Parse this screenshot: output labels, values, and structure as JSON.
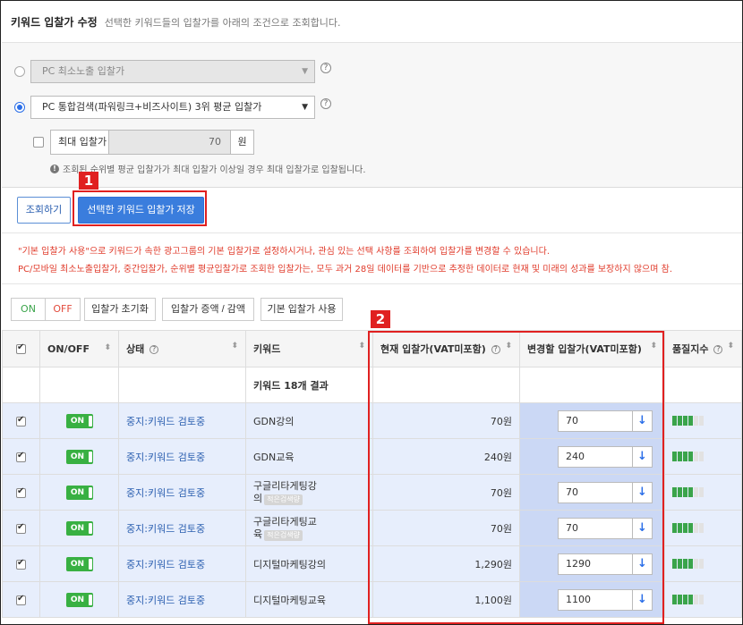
{
  "header": {
    "title": "키워드 입찰가 수정",
    "description": "선택한 키워드들의 입찰가를 아래의 조건으로 조회합니다."
  },
  "conditions": {
    "option1": "PC 최소노출 입찰가",
    "option2": "PC 통합검색(파워링크+비즈사이트) 3위 평균 입찰가",
    "max_bid_label": "최대 입찰가",
    "max_bid_value": "70",
    "max_bid_unit": "원",
    "note": "조회된 순위별 평균 입찰가가 최대 입찰가 이상일 경우 최대 입찰가로 입찰됩니다.",
    "help_glyph": "?",
    "info_glyph": "!",
    "arrow_glyph": "▼"
  },
  "actions": {
    "query": "조회하기",
    "save": "선택한 키워드 입찰가 저장"
  },
  "notice": {
    "line1": "\"기본 입찰가 사용\"으로 키워드가 속한 광고그룹의 기본 입찰가로 설정하시거나, 관심 있는 선택 사항를 조회하여 입찰가를 변경할 수 있습니다.",
    "line2": "PC/모바일 최소노출입찰가, 중간입찰가, 순위별 평균입찰가로 조회한 입찰가는, 모두 과거 28일 데이터를 기반으로 추정한 데이터로 현재 및 미래의 성과를 보장하지 않으며 참."
  },
  "toolbar": {
    "on": "ON",
    "off": "OFF",
    "reset": "입찰가 초기화",
    "adjust": "입찰가 증액 / 감액",
    "default": "기본 입찰가 사용"
  },
  "table": {
    "headers": {
      "onoff": "ON/OFF",
      "status": "상태",
      "keyword": "키워드",
      "current_bid": "현재 입찰가(VAT미포함)",
      "new_bid": "변경할 입찰가(VAT미포함)",
      "quality": "품질지수"
    },
    "sort_glyph": "⬍",
    "summary": "키워드 18개 결과",
    "toggle_label": "ON",
    "tag_label": "적은검색량",
    "apply_glyph": "↓",
    "rows": [
      {
        "status": "중지:키워드 검토중",
        "keyword": "GDN강의",
        "current_bid": "70원",
        "new_bid": "70",
        "quality": 4
      },
      {
        "status": "중지:키워드 검토중",
        "keyword": "GDN교육",
        "current_bid": "240원",
        "new_bid": "240",
        "quality": 4
      },
      {
        "status": "중지:키워드 검토중",
        "keyword_line1": "구글리타게팅강",
        "keyword_line2": "의",
        "current_bid": "70원",
        "new_bid": "70",
        "quality": 4
      },
      {
        "status": "중지:키워드 검토중",
        "keyword_line1": "구글리타게팅교",
        "keyword_line2": "육",
        "current_bid": "70원",
        "new_bid": "70",
        "quality": 4
      },
      {
        "status": "중지:키워드 검토중",
        "keyword": "디지털마케팅강의",
        "current_bid": "1,290원",
        "new_bid": "1290",
        "quality": 4
      },
      {
        "status": "중지:키워드 검토중",
        "keyword": "디지털마케팅교육",
        "current_bid": "1,100원",
        "new_bid": "1100",
        "quality": 4
      }
    ]
  },
  "annotations": {
    "label1": "1",
    "label2": "2",
    "color": "#e02020"
  }
}
